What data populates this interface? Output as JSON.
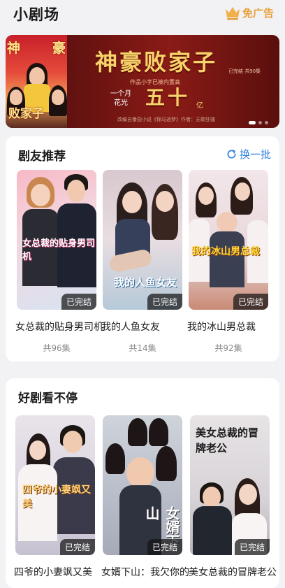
{
  "header": {
    "title": "小剧场",
    "ad_free_label": "免广告",
    "ad_free_icon": "crown-icon"
  },
  "banner": {
    "title": "神豪败家子",
    "poster_chars": [
      "神",
      "豪",
      "败家子"
    ],
    "status": "已完结  共90集",
    "tagline_small": "作品小字已被内置高",
    "tagline_line1": "一个月",
    "tagline_line2": "花光",
    "amount": "五十",
    "amount_unit": "亿",
    "source": "改编自番茄小说《锦马逍梦》作者：无歌狂骚",
    "pages": 3,
    "active_page": 0
  },
  "recommend": {
    "title": "剧友推荐",
    "refresh_label": "换一批",
    "refresh_icon": "refresh-icon",
    "items": [
      {
        "title": "女总裁的贴身男司机",
        "count": "共96集",
        "badge": "已完结",
        "poster_text": "女总裁的贴身男司机"
      },
      {
        "title": "我的人鱼女友",
        "count": "共14集",
        "badge": "已完结",
        "poster_text": "我的人鱼女友"
      },
      {
        "title": "我的冰山男总裁",
        "count": "共92集",
        "badge": "已完结",
        "poster_text": "我的冰山男总裁"
      }
    ]
  },
  "nonstop": {
    "title": "好剧看不停",
    "items": [
      {
        "title": "四爷的小妻飒又美",
        "badge": "已完结",
        "poster_text": "四爷的小妻飒又美"
      },
      {
        "title": "女婿下山：我欠你的",
        "badge": "已完结",
        "poster_text": "女婿下山"
      },
      {
        "title": "美女总裁的冒牌老公",
        "badge": "已完结",
        "poster_text": "美女总裁的冒牌老公"
      }
    ]
  },
  "colors": {
    "accent": "#2f7fe0",
    "ad_free": "#e7a03a",
    "banner_bg": "#6e1412"
  }
}
